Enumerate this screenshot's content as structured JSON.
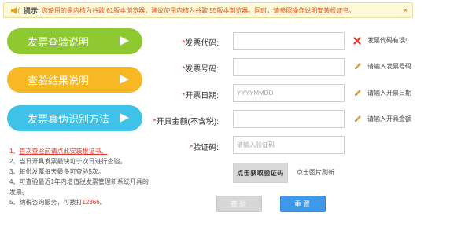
{
  "notice": {
    "label": "提示:",
    "text": "您使用的是内核为谷歌 61版本浏览器，建议使用内核为谷歌 55版本浏览器。同时，请参照操作说明安装根证书。",
    "close": "×"
  },
  "sidebar": {
    "buttons": [
      {
        "label": "发票查验说明",
        "color": "#8ec932"
      },
      {
        "label": "查验结果说明",
        "color": "#f7b824"
      },
      {
        "label": "发票真伪识别方法",
        "color": "#40c2e8"
      }
    ]
  },
  "notes": [
    {
      "num": "1、",
      "text": "首次查验前请点此安装根证书。"
    },
    {
      "num": "2、",
      "text": "当日开具发票最快可于次日进行查验。"
    },
    {
      "num": "3、",
      "text": "每份发票每天最多可查验5次。"
    },
    {
      "num": "4、",
      "text": "可查验最近1年内增值税发票管理新系统开具的发票。"
    },
    {
      "num": "5、",
      "text_before": "纳税咨询服务，可拨打",
      "hotline": "12366",
      "text_after": "。"
    }
  ],
  "form": {
    "invoice_code": {
      "star": "*",
      "label": "发票代码:",
      "value": "",
      "placeholder": "",
      "hint": "发票代码有误!"
    },
    "invoice_number": {
      "star": "*",
      "label": "发票号码:",
      "value": "",
      "placeholder": "",
      "hint": "请输入发票号码"
    },
    "issue_date": {
      "star": "*",
      "label": "开票日期:",
      "value": "",
      "placeholder": "YYYYMMDD",
      "hint": "请输入开票日期"
    },
    "amount": {
      "star": "*",
      "label": "开具金额(不含税):",
      "value": "",
      "placeholder": "",
      "hint": "请输入开具金额"
    },
    "captcha": {
      "star": "*",
      "label": "验证码:",
      "value": "",
      "placeholder": "请输入验证码"
    },
    "captcha_image_text": "点击获取验证码",
    "captcha_hint": "点击图片刷新"
  },
  "actions": {
    "check": "查验",
    "reset": "重置"
  },
  "colors": {
    "error": "#e8382b",
    "accent_blue": "#3f99e8",
    "pencil": "#d98a3c"
  }
}
